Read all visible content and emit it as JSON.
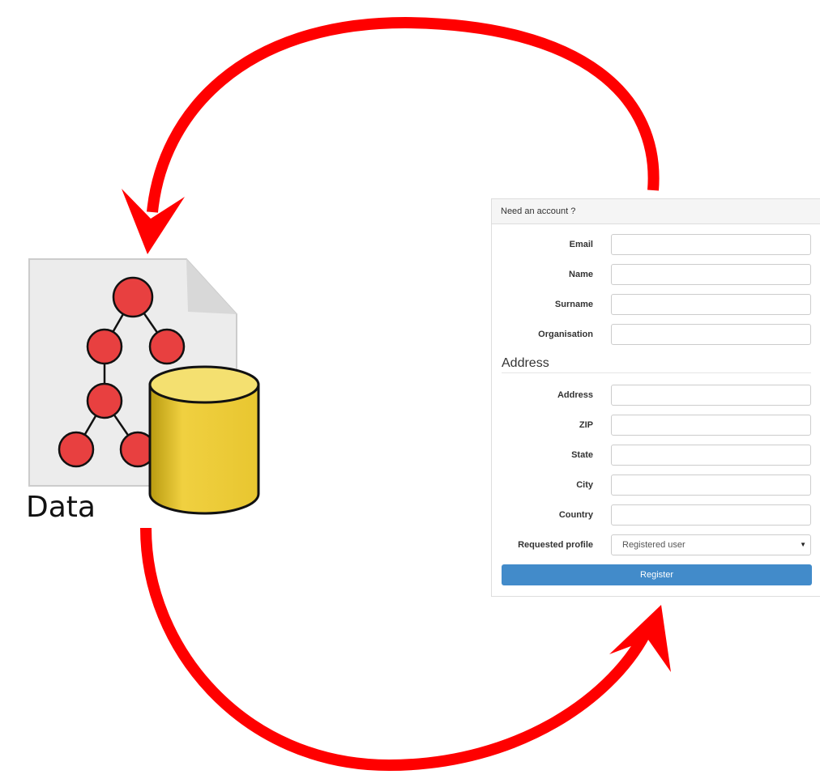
{
  "diagram": {
    "data_label": "Data",
    "arrow_color": "#ff0000",
    "node_color": "#e84040",
    "database_color": "#e8c630"
  },
  "form": {
    "header": "Need an account ?",
    "fields": [
      {
        "label": "Email",
        "value": ""
      },
      {
        "label": "Name",
        "value": ""
      },
      {
        "label": "Surname",
        "value": ""
      },
      {
        "label": "Organisation",
        "value": ""
      }
    ],
    "address_section": "Address",
    "address_fields": [
      {
        "label": "Address",
        "value": ""
      },
      {
        "label": "ZIP",
        "value": ""
      },
      {
        "label": "State",
        "value": ""
      },
      {
        "label": "City",
        "value": ""
      },
      {
        "label": "Country",
        "value": ""
      }
    ],
    "profile": {
      "label": "Requested profile",
      "value": "Registered user"
    },
    "register_label": "Register",
    "button_color": "#428bca"
  }
}
